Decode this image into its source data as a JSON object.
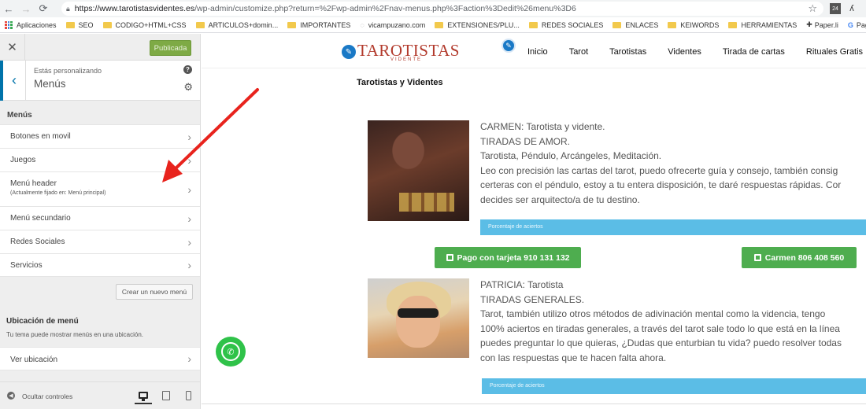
{
  "browser": {
    "url_host": "https://www.tarotistasvidentes.es",
    "url_path": "/wp-admin/customize.php?return=%2Fwp-admin%2Fnav-menus.php%3Faction%3Dedit%26menu%3D6",
    "ext_badge": "24"
  },
  "bookmarks": [
    "Aplicaciones",
    "SEO",
    "CODIGO+HTML+CSS",
    "ARTICULOS+domin...",
    "IMPORTANTES",
    "vicampuzano.com",
    "EXTENSIONES/PLU...",
    "REDES SOCIALES",
    "ENLACES",
    "KEIWORDS",
    "HERRAMIENTAS",
    "Paper.li",
    "Pagos de Google"
  ],
  "customizer": {
    "publish_label": "Publicada",
    "customizing_label": "Estás personalizando",
    "section_name": "Menús",
    "menus_heading": "Menús",
    "menus": [
      {
        "label": "Botones en movil",
        "sub": ""
      },
      {
        "label": "Juegos",
        "sub": ""
      },
      {
        "label": "Menú header",
        "sub": "(Actualmente fijado en: Menú principal)"
      },
      {
        "label": "Menú secundario",
        "sub": ""
      },
      {
        "label": "Redes Sociales",
        "sub": ""
      },
      {
        "label": "Servicios",
        "sub": ""
      }
    ],
    "create_menu_label": "Crear un nuevo menú",
    "location_title": "Ubicación de menú",
    "location_desc": "Tu tema puede mostrar menús en una ubicación.",
    "view_location_label": "Ver ubicación",
    "hide_controls_label": "Ocultar controles"
  },
  "site": {
    "logo_text": "TAROTISTAS",
    "logo_sub": "VIDENTE",
    "nav": [
      "Inicio",
      "Tarot",
      "Tarotistas",
      "Videntes",
      "Tirada de cartas",
      "Rituales Gratis"
    ],
    "page_title": "Tarotistas y Videntes",
    "card1_lines": [
      "CARMEN: Tarotista y vidente.",
      "TIRADAS DE AMOR.",
      "Tarotista, Péndulo, Arcángeles, Meditación.",
      "Leo con precisión las cartas del tarot, puedo ofrecerte guía y consejo, también consig",
      "certeras con el péndulo, estoy a tu entera disposición, te daré respuestas rápidas. Cor",
      "decides ser arquitecto/a de tu destino."
    ],
    "bar_label": "Porcentaje de aciertos",
    "btn_card": "Pago con tarjeta 910 131 132",
    "btn_phone": "Carmen 806 408 560",
    "card2_lines": [
      "PATRICIA: Tarotista",
      "TIRADAS GENERALES.",
      "Tarot, también utilizo otros métodos de adivinación mental como la videncia, tengo",
      "100% aciertos en tiradas generales, a través del tarot sale todo lo que está en la línea",
      "puedes preguntar lo que quieras, ¿Dudas que enturbian tu vida? puedo resolver todas",
      "con las respuestas que te hacen falta ahora."
    ]
  },
  "colors": {
    "wp_blue": "#0073aa",
    "publish_green": "#7eaa45",
    "arrow_red": "#e8231d",
    "button_green": "#4ead4f",
    "bar_blue": "#5bbde6",
    "logo_red": "#b23a2c"
  }
}
